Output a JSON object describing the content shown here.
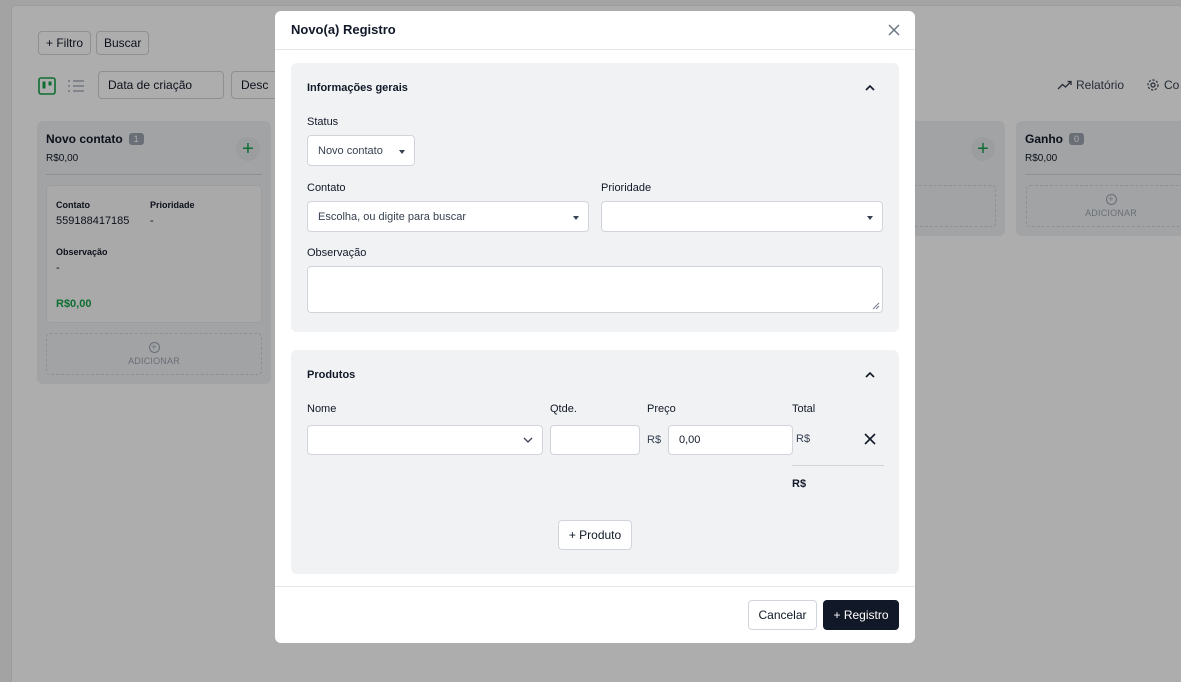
{
  "toolbar": {
    "filter_label": "+ Filtro",
    "search_label": "Buscar",
    "sort_field": "Data de criação",
    "sort_order": "Desc",
    "report_label": "Relatório",
    "config_label": "Co"
  },
  "board": {
    "columns": [
      {
        "title": "Novo contato",
        "count": "1",
        "total": "R$0,00",
        "add_label": "ADICIONAR",
        "card": {
          "contact_label": "Contato",
          "contact_value": "559188417185",
          "priority_label": "Prioridade",
          "priority_value": "-",
          "note_label": "Observação",
          "note_value": "-",
          "amount": "R$0,00"
        }
      },
      {
        "title": "Ganho",
        "count": "0",
        "total": "R$0,00",
        "add_label": "ADICIONAR"
      }
    ]
  },
  "modal": {
    "title": "Novo(a) Registro",
    "general": {
      "title": "Informações gerais",
      "status_label": "Status",
      "status_value": "Novo contato",
      "contact_label": "Contato",
      "contact_placeholder": "Escolha, ou digite para buscar",
      "priority_label": "Prioridade",
      "priority_value": "",
      "note_label": "Observação",
      "note_value": ""
    },
    "products": {
      "title": "Produtos",
      "col_name": "Nome",
      "col_qty": "Qtde.",
      "col_price": "Preço",
      "col_total": "Total",
      "currency": "R$",
      "price_value": "0,00",
      "row_total": "R$",
      "grand_total": "R$",
      "add_product_label": "+ Produto"
    },
    "cancel_label": "Cancelar",
    "submit_label": "+ Registro"
  },
  "colors": {
    "accent_green": "#16a34a",
    "primary_dark": "#111827"
  }
}
